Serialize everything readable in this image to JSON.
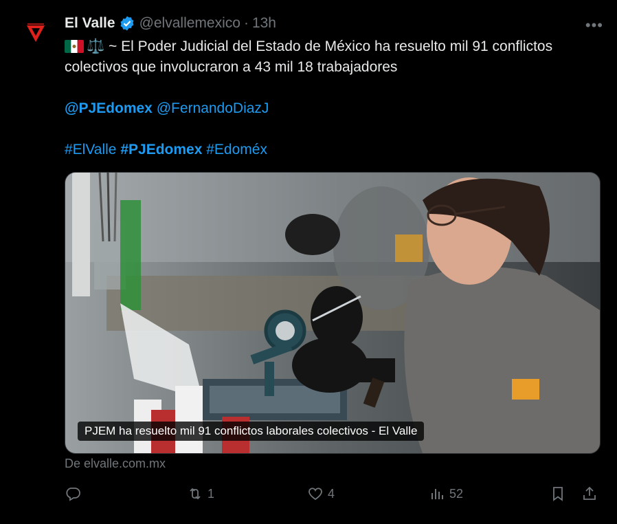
{
  "tweet": {
    "author_name": "El Valle",
    "handle": "@elvallemexico",
    "separator": "·",
    "time": "13h",
    "more_label": "•••",
    "text_line1": "~ El Poder Judicial del Estado de México ha resuelto mil 91 conflictos",
    "text_line2": "colectivos que involucraron a 43 mil 18 trabajadores",
    "mention1": "@PJEdomex",
    "mention2": "@FernandoDiazJ",
    "hashtag1": "#ElValle",
    "hashtag2": "#PJEdomex",
    "hashtag3": "#Edoméx",
    "emoji_scales": "⚖️"
  },
  "media": {
    "caption": "PJEM ha resuelto mil 91 conflictos laborales colectivos - El Valle"
  },
  "source": "De elvalle.com.mx",
  "actions": {
    "reply_count": "",
    "retweet_count": "1",
    "like_count": "4",
    "views_count": "52"
  },
  "colors": {
    "background": "#000000",
    "text": "#e7e9ea",
    "muted": "#71767b",
    "link": "#1d9bf0",
    "verified": "#1d9bf0"
  },
  "icons": [
    "verified-badge-icon",
    "more-icon",
    "mexico-flag-icon",
    "scales-icon",
    "reply-icon",
    "retweet-icon",
    "like-icon",
    "views-icon",
    "bookmark-icon",
    "share-icon"
  ]
}
